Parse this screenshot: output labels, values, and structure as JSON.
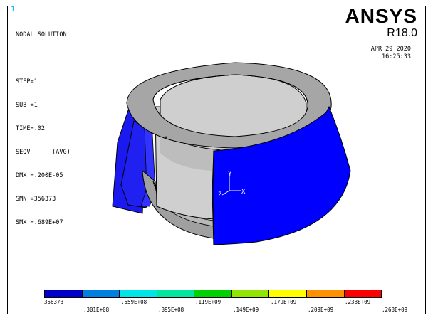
{
  "window_number": "1",
  "result_info": {
    "lines": [
      "NODAL SOLUTION",
      "",
      "STEP=1",
      "SUB =1",
      "TIME=.02",
      "SEQV      (AVG)",
      "DMX =.200E-05",
      "SMN =356373",
      "SMX =.689E+07"
    ]
  },
  "brand": {
    "name": "ANSYS",
    "release": "R18.0"
  },
  "timestamp": {
    "date": "APR 29 2020",
    "time": "16:25:33"
  },
  "triad": {
    "y": "Y",
    "z": "Z",
    "x": "X"
  },
  "legend": {
    "colors": [
      "#0000cc",
      "#0080e0",
      "#00e6e6",
      "#00e6a0",
      "#00d200",
      "#90e600",
      "#ffff00",
      "#ff9000",
      "#ff0000"
    ],
    "labels_bottom_row": [
      "356373",
      ".559E+08",
      ".119E+09",
      ".179E+09",
      ".238E+09"
    ],
    "labels_top_row": [
      ".301E+08",
      ".895E+08",
      ".149E+09",
      ".209E+09",
      ".268E+09"
    ]
  }
}
